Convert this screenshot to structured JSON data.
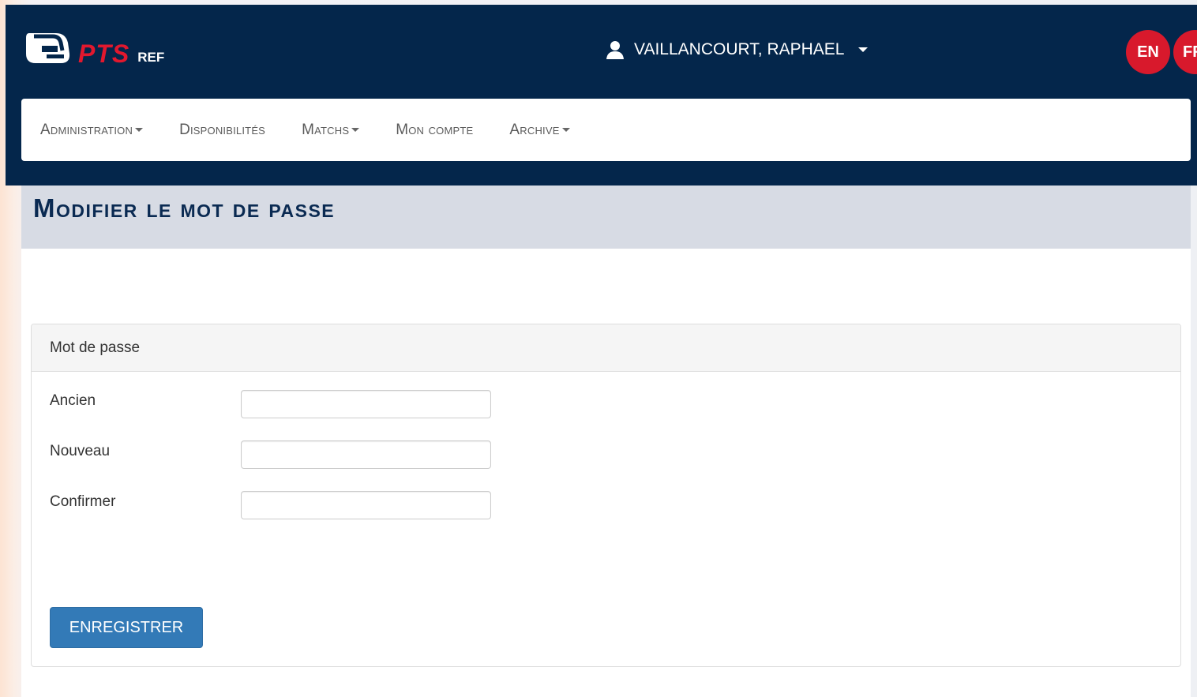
{
  "header": {
    "logo_primary": "PTS",
    "logo_secondary": "REF",
    "user_name": "VAILLANCOURT, RAPHAEL",
    "user_icon": "user-icon",
    "languages": [
      "EN",
      "FR"
    ]
  },
  "nav": {
    "items": [
      {
        "label": "Administration",
        "has_dropdown": true
      },
      {
        "label": "Disponibilités",
        "has_dropdown": false
      },
      {
        "label": "Matchs",
        "has_dropdown": true
      },
      {
        "label": "Mon compte",
        "has_dropdown": false
      },
      {
        "label": "Archive",
        "has_dropdown": true
      }
    ]
  },
  "page": {
    "title": "Modifier le mot de passe"
  },
  "form": {
    "panel_title": "Mot de passe",
    "fields": [
      {
        "label": "Ancien",
        "value": ""
      },
      {
        "label": "Nouveau",
        "value": ""
      },
      {
        "label": "Confirmer",
        "value": ""
      }
    ],
    "submit_label": "ENREGISTRER"
  },
  "colors": {
    "header_bg": "#04264b",
    "accent_red": "#d8192c",
    "primary_button": "#337ab7",
    "page_head_bg": "#d7dbe4"
  }
}
